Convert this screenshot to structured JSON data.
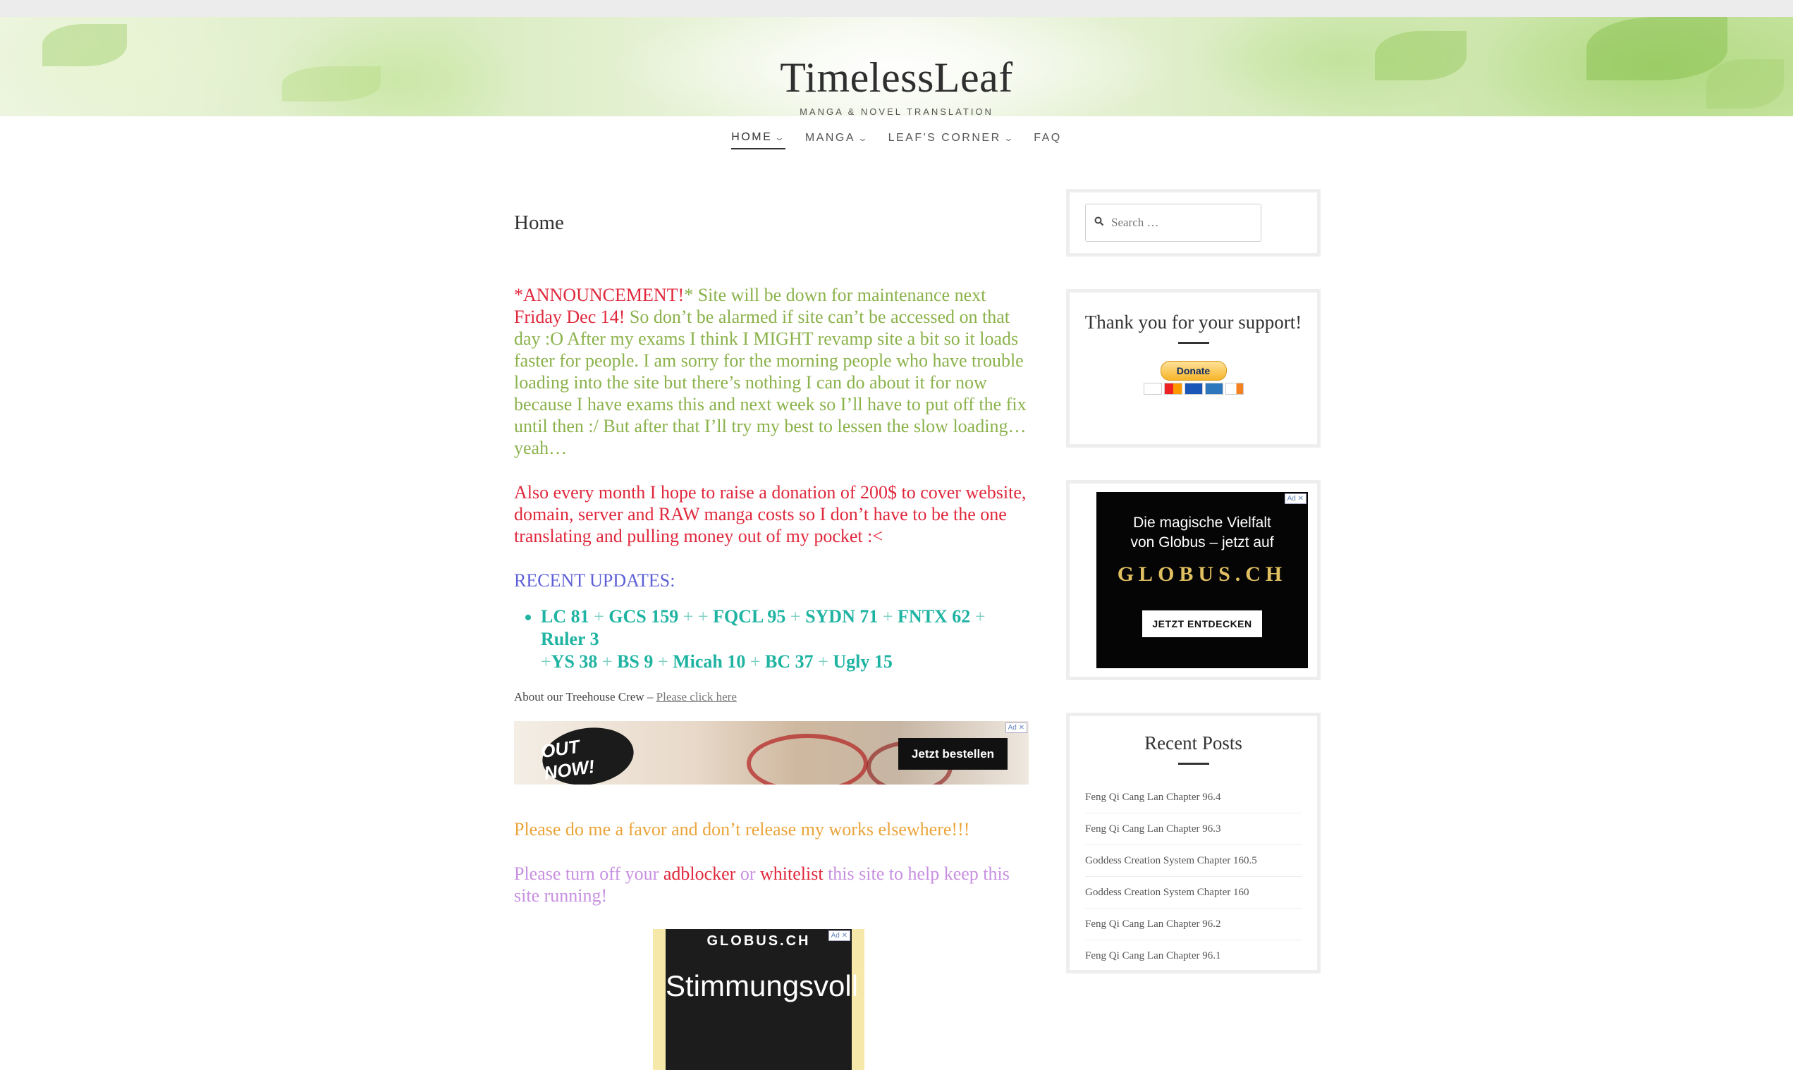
{
  "site": {
    "title": "TimelessLeaf",
    "tagline": "MANGA & NOVEL TRANSLATION"
  },
  "nav": [
    {
      "label": "HOME",
      "active": true,
      "has_dropdown": true
    },
    {
      "label": "MANGA",
      "active": false,
      "has_dropdown": true
    },
    {
      "label": "LEAF'S CORNER",
      "active": false,
      "has_dropdown": true
    },
    {
      "label": "FAQ",
      "active": false,
      "has_dropdown": false
    }
  ],
  "icons": {
    "dropdown": "chevron-down-icon",
    "search": "search-icon"
  },
  "main": {
    "page_title": "Home",
    "announcement": {
      "prefix": "*",
      "highlight": "ANNOUNCEMENT!",
      "text1": "* Site will be down for maintenance next ",
      "date": "Friday Dec 14!",
      "text2": " So don’t be alarmed if site can’t be accessed on that day :O After my exams I think I MIGHT revamp site a bit so it loads faster for people. I am sorry for the morning people who have trouble loading into the site but there’s nothing I can do about it for now because I have exams this and next week so I’ll have to put off the fix until then :/ But after that I’ll try my best to lessen the slow loading…yeah…"
    },
    "donation_text": "Also every month I hope to raise a donation of 200$ to cover website, domain, server and RAW manga costs so I don’t have to be the one translating and pulling money out of my pocket :<",
    "recent_updates_label": "RECENT UPDATES:",
    "updates_line1": [
      {
        "text": "LC 81",
        "sep": " + "
      },
      {
        "text": "GCS 159",
        "sep": " + + "
      },
      {
        "text": "FQCL 95",
        "sep": " + "
      },
      {
        "text": "SYDN 71",
        "sep": " + "
      },
      {
        "text": "FNTX 62",
        "sep": " + "
      },
      {
        "text": "Ruler 3",
        "sep": ""
      }
    ],
    "updates_line2": [
      {
        "text": "YS 38",
        "sep": " + "
      },
      {
        "text": "BS 9",
        "sep": " + "
      },
      {
        "text": "Micah 10",
        "sep": " + "
      },
      {
        "text": "BC 37",
        "sep": " + "
      },
      {
        "text": "Ugly 15",
        "sep": ""
      }
    ],
    "updates_line2_prefix": "+",
    "about_text": "About our Treehouse Crew – ",
    "about_link": "Please click here",
    "favor_text": "Please do me a favor and don’t release my works elsewhere!!!",
    "adblock": {
      "t1": "Please turn off your ",
      "adblocker": "adblocker",
      "t2": " or ",
      "whitelist": "whitelist",
      "t3": " this site to help keep this site running!"
    },
    "ad_banner": {
      "badge": "OUT NOW!",
      "button": "Jetzt bestellen",
      "tag": "Ad ✕"
    },
    "ad_bottom": {
      "brand": "GLOBUS.CH",
      "headline": "Stimmungsvoll",
      "tag": "Ad ✕"
    }
  },
  "sidebar": {
    "search_placeholder": "Search …",
    "support_title": "Thank you for your support!",
    "donate_label": "Donate",
    "ad": {
      "line1": "Die magische Vielfalt",
      "line2": "von Globus – jetzt auf",
      "brand": "GLOBUS.CH",
      "button": "JETZT ENTDECKEN",
      "tag": "Ad ✕"
    },
    "recent_posts_title": "Recent Posts",
    "recent_posts": [
      "Feng Qi Cang Lan Chapter 96.4",
      "Feng Qi Cang Lan Chapter 96.3",
      "Goddess Creation System Chapter 160.5",
      "Goddess Creation System Chapter 160",
      "Feng Qi Cang Lan Chapter 96.2",
      "Feng Qi Cang Lan Chapter 96.1"
    ]
  },
  "colors": {
    "announcement_green": "#8bb24b",
    "alert_red": "#e0283c",
    "updates_blue": "#5c5fd6",
    "updates_teal": "#1fb3a2",
    "favor_orange": "#eba43a",
    "adblock_purple": "#c790e0"
  }
}
